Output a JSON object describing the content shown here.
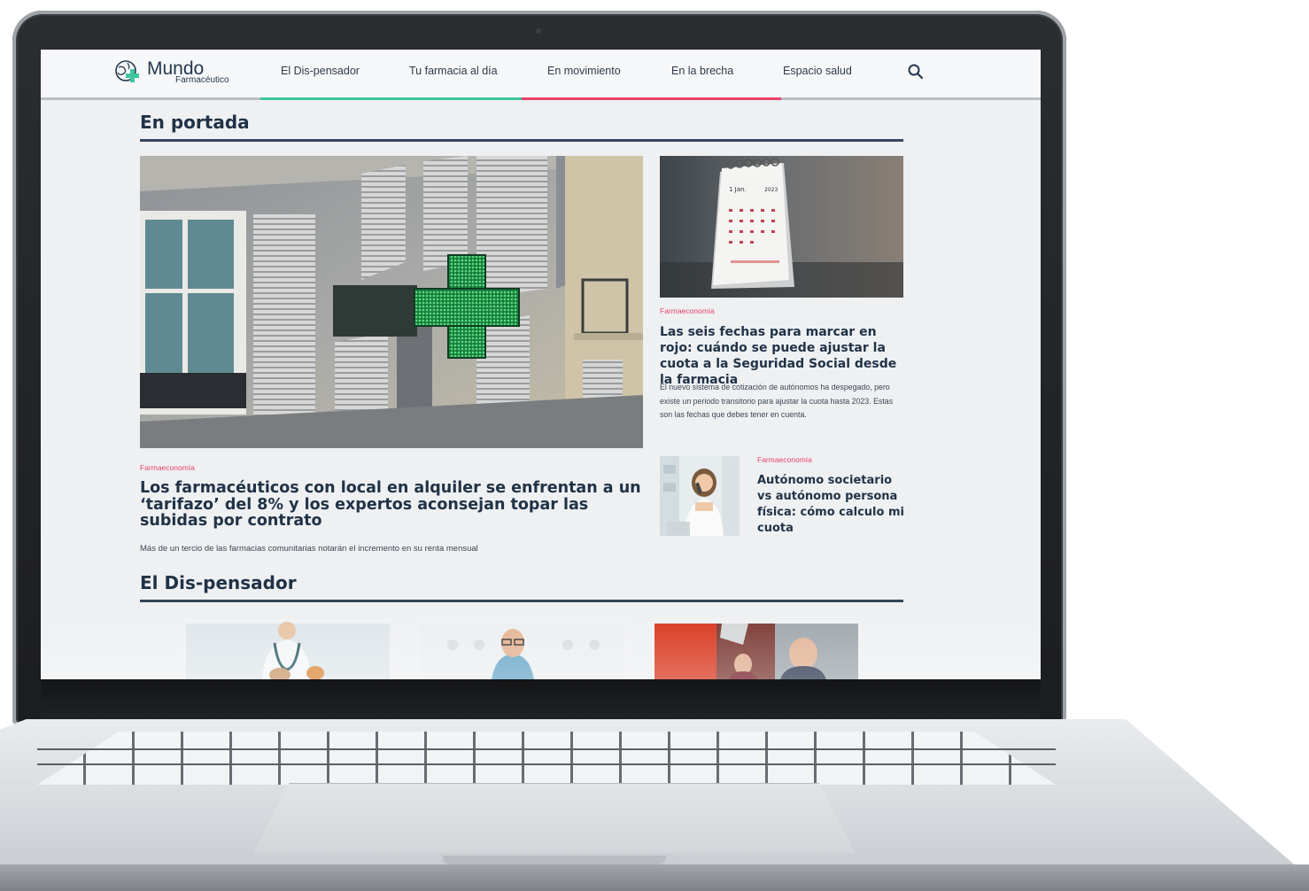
{
  "site": {
    "logo": {
      "name": "Mundo",
      "sub": "Farmacéutico"
    },
    "nav": [
      {
        "label": "El Dis-pensador"
      },
      {
        "label": "Tu farmacia al día"
      },
      {
        "label": "En movimiento"
      },
      {
        "label": "En la brecha"
      },
      {
        "label": "Espacio salud"
      }
    ],
    "search_icon": "search-icon"
  },
  "sections": {
    "portada_title": "En portada",
    "dispensador_title": "El Dis-pensador"
  },
  "main_story": {
    "kicker": "Farmaeconomía",
    "title": "Los farmacéuticos con local en alquiler se enfrentan a un ‘tarifazo’ del 8% y los expertos aconsejan topar las subidas por contrato",
    "summary": "Más de un tercio de las farmacias comunitarias notarán el incremento en su renta mensual"
  },
  "side_story": {
    "kicker": "Farmaeconomía",
    "title": "Las seis fechas para marcar en rojo: cuándo se puede ajustar la cuota a la Seguridad Social desde la farmacia",
    "summary": "El nuevo sistema de cotización de autónomos ha despegado, pero existe un periodo transitorio para ajustar la cuota hasta 2023. Estas son las fechas que debes tener en cuenta.",
    "image_text": {
      "month": "1 Jan.",
      "year": "2023"
    }
  },
  "small_story": {
    "kicker": "Farmaeconomía",
    "title": "Autónomo societario vs autónomo persona física: cómo calculo mi cuota"
  },
  "colors": {
    "accent_green": "#3ec6a0",
    "accent_pink": "#e8436b",
    "title_navy": "#1f3247"
  }
}
